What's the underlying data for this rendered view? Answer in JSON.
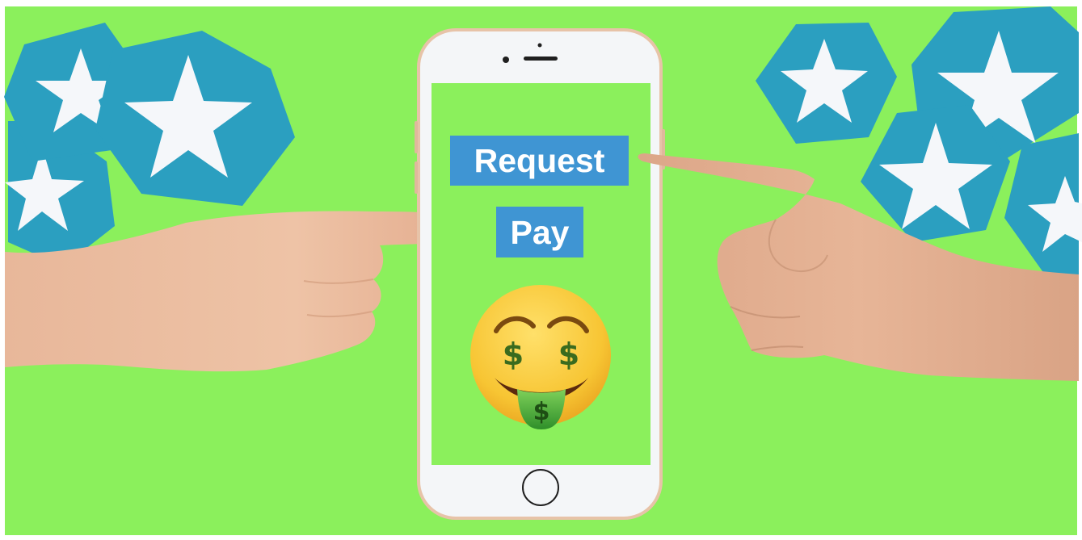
{
  "screen": {
    "request_label": "Request",
    "pay_label": "Pay"
  },
  "icons": {
    "stars": "white-star-on-blue-hexagon",
    "emoji": "money-mouth-face"
  },
  "colors": {
    "background": "#8bf05c",
    "hexagon": "#2b9fc0",
    "star": "#f5f7fa",
    "label_box": "#3f95d3",
    "phone_body": "#f4f6f8",
    "phone_frame": "#e7c3a8",
    "screen": "#8bf05c",
    "skin": "#e9b99b",
    "emoji_face": "#f7c533",
    "money_green": "#4caf3a"
  }
}
